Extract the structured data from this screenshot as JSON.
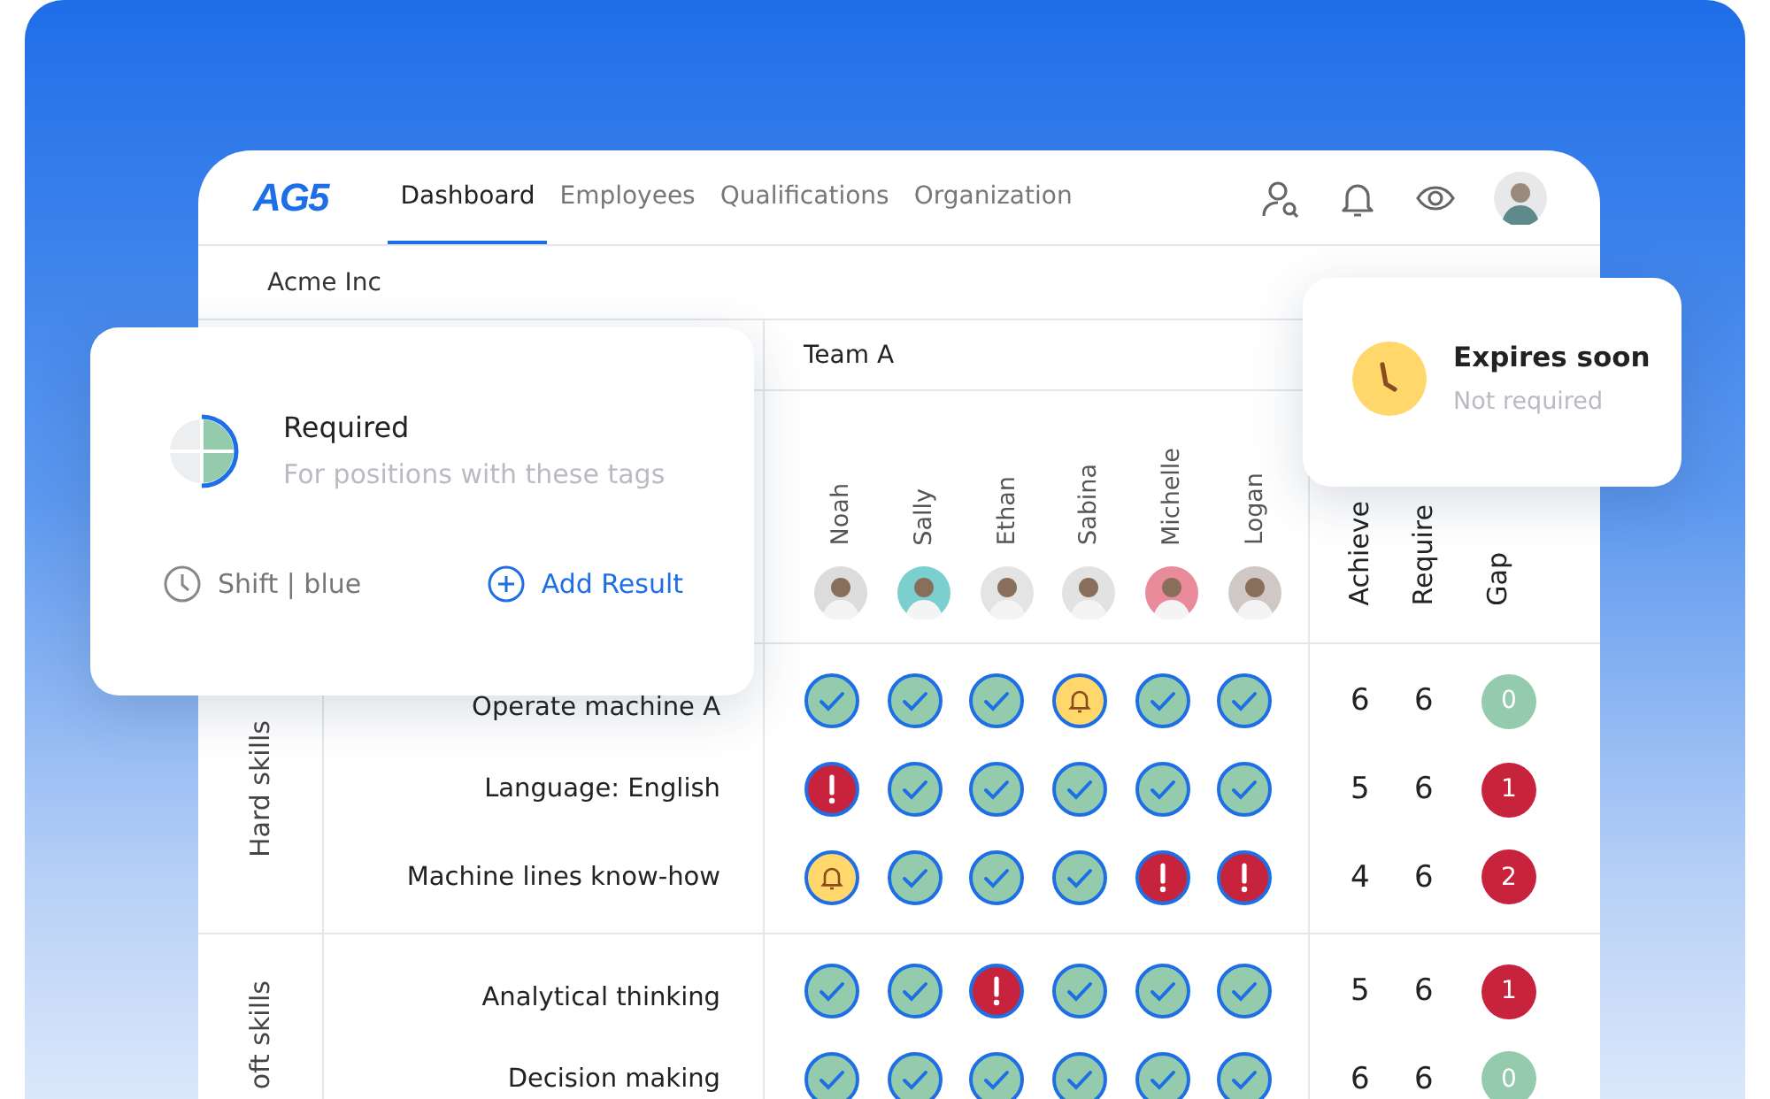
{
  "nav": {
    "logo": "AG5",
    "tabs": [
      {
        "label": "Dashboard",
        "selected": true
      },
      {
        "label": "Employees",
        "selected": false
      },
      {
        "label": "Qualifications",
        "selected": false
      },
      {
        "label": "Organization",
        "selected": false
      }
    ]
  },
  "company": "Acme Inc",
  "team": "Team A",
  "people": [
    "Noah",
    "Sally",
    "Ethan",
    "Sabina",
    "Michelle",
    "Logan"
  ],
  "summary_columns": [
    "Achieve",
    "Require",
    "Gap"
  ],
  "groups": [
    {
      "label": "Hard skills",
      "skills": [
        {
          "name": "Operate machine A",
          "results": [
            {
              "kind": "ok"
            },
            {
              "kind": "ok"
            },
            {
              "kind": "ok"
            },
            {
              "kind": "warn"
            },
            {
              "kind": "ok"
            },
            {
              "kind": "ok"
            }
          ],
          "achieved": "6",
          "required": "6",
          "gap": {
            "value": "0",
            "kind": "ok"
          }
        },
        {
          "name": "Language: English",
          "results": [
            {
              "kind": "error"
            },
            {
              "kind": "ok"
            },
            {
              "kind": "ok"
            },
            {
              "kind": "ok"
            },
            {
              "kind": "ok"
            },
            {
              "kind": "ok"
            }
          ],
          "achieved": "5",
          "required": "6",
          "gap": {
            "value": "1",
            "kind": "missing"
          }
        },
        {
          "name": "Machine lines know-how",
          "results": [
            {
              "kind": "warn"
            },
            {
              "kind": "ok"
            },
            {
              "kind": "ok"
            },
            {
              "kind": "ok"
            },
            {
              "kind": "error"
            },
            {
              "kind": "error"
            }
          ],
          "achieved": "4",
          "required": "6",
          "gap": {
            "value": "2",
            "kind": "missing"
          }
        }
      ]
    },
    {
      "label": "oft skills",
      "skills": [
        {
          "name": "Analytical thinking",
          "results": [
            {
              "kind": "ok"
            },
            {
              "kind": "ok"
            },
            {
              "kind": "error"
            },
            {
              "kind": "ok"
            },
            {
              "kind": "ok"
            },
            {
              "kind": "ok"
            }
          ],
          "achieved": "5",
          "required": "6",
          "gap": {
            "value": "1",
            "kind": "missing"
          }
        },
        {
          "name": "Decision making",
          "results": [
            {
              "kind": "ok"
            },
            {
              "kind": "ok"
            },
            {
              "kind": "ok"
            },
            {
              "kind": "ok"
            },
            {
              "kind": "ok"
            },
            {
              "kind": "ok"
            }
          ],
          "achieved": "6",
          "required": "6",
          "gap": {
            "value": "0",
            "kind": "ok"
          }
        }
      ]
    }
  ],
  "required_card": {
    "title": "Required",
    "subtitle": "For positions with these tags",
    "tag": "Shift | blue",
    "action": "Add Result"
  },
  "expires_card": {
    "title": "Expires soon",
    "subtitle": "Not required"
  }
}
